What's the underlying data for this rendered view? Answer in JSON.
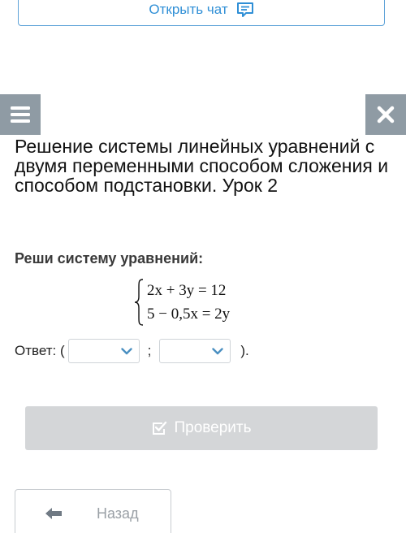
{
  "chat": {
    "label": "Открыть чат",
    "icon": "chat-icon"
  },
  "nav": {
    "menu_icon": "hamburger-menu-icon",
    "close_icon": "close-icon"
  },
  "lesson": {
    "title": "Решение системы линейных уравнений с двумя переменными способом сложения и способом подстановки. Урок 2"
  },
  "task": {
    "prompt": "Реши систему уравнений:",
    "equations": [
      "2x + 3y = 12",
      "5 − 0,5x = 2y"
    ]
  },
  "answer": {
    "label": "Ответ: (",
    "separator": ";",
    "closing": ").",
    "first_value": "",
    "second_value": ""
  },
  "actions": {
    "check_label": "Проверить",
    "back_label": "Назад"
  },
  "colors": {
    "accent": "#2f8fd6",
    "side_button": "#8f9ba4",
    "check_disabled": "#d4d6d8"
  }
}
